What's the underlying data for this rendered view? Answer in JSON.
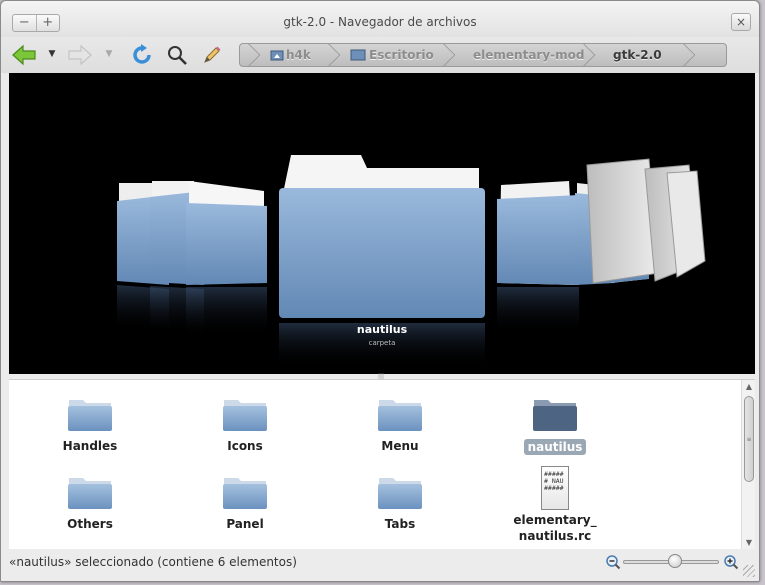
{
  "window": {
    "title": "gtk-2.0 - Navegador de archivos",
    "min_glyph": "−",
    "max_glyph": "+",
    "close_glyph": "×"
  },
  "toolbar": {
    "icons": [
      "back-icon",
      "back-dropdown-icon",
      "forward-icon",
      "forward-dropdown-icon",
      "reload-icon",
      "search-icon",
      "edit-icon"
    ]
  },
  "pathbar": {
    "crumbs": [
      "h4k",
      "Escritorio",
      "elementary-mod",
      "gtk-2.0"
    ],
    "active_index": 3
  },
  "coverflow": {
    "selected_name": "nautilus",
    "selected_type": "carpeta"
  },
  "files": [
    {
      "label": "Handles",
      "kind": "folder"
    },
    {
      "label": "Icons",
      "kind": "folder"
    },
    {
      "label": "Menu",
      "kind": "folder"
    },
    {
      "label": "nautilus",
      "kind": "folder",
      "selected": true
    },
    {
      "label": "Others",
      "kind": "folder"
    },
    {
      "label": "Panel",
      "kind": "folder"
    },
    {
      "label": "Tabs",
      "kind": "folder"
    },
    {
      "label": "elementary_\nnautilus.rc",
      "kind": "text-file",
      "preview": "#####\n# NAU\n#####"
    }
  ],
  "status": {
    "text": "«nautilus» seleccionado (contiene 6 elementos)"
  },
  "zoom": {
    "level": 0.55
  },
  "colors": {
    "folder_body": "#7fa4cc",
    "folder_selected": "#4d6482",
    "selection_bg": "#9aa7b4",
    "coverflow_bg": "#000000"
  }
}
